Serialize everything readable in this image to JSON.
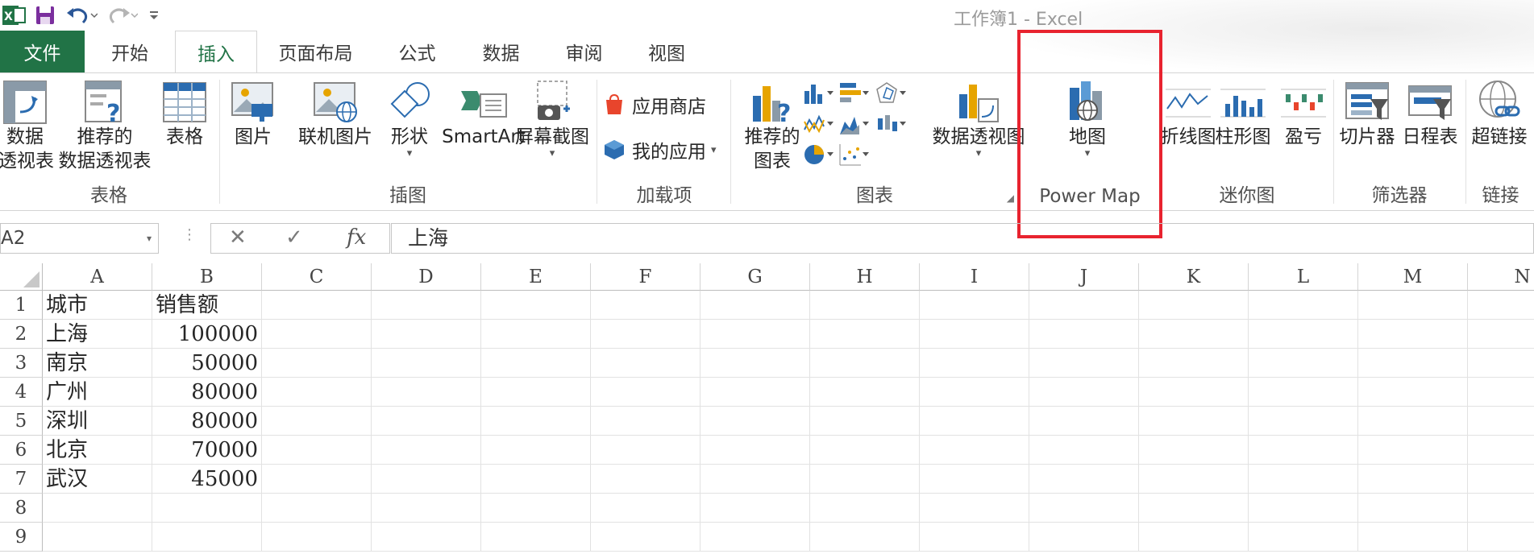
{
  "window": {
    "title": "工作簿1 - Excel"
  },
  "tabs": [
    {
      "label": "文件"
    },
    {
      "label": "开始"
    },
    {
      "label": "插入"
    },
    {
      "label": "页面布局"
    },
    {
      "label": "公式"
    },
    {
      "label": "数据"
    },
    {
      "label": "审阅"
    },
    {
      "label": "视图"
    }
  ],
  "ribbon": {
    "tables": {
      "label": "表格",
      "pivot": [
        "数据",
        "透视表"
      ],
      "recommended_pivot": [
        "推荐的",
        "数据透视表"
      ],
      "table": "表格"
    },
    "illustrations": {
      "label": "插图",
      "picture": "图片",
      "online_picture": "联机图片",
      "shapes": "形状",
      "smartart": "SmartArt",
      "screenshot": "屏幕截图"
    },
    "addins": {
      "label": "加载项",
      "store": "应用商店",
      "my_apps": "我的应用"
    },
    "charts": {
      "label": "图表",
      "recommended": [
        "推荐的",
        "图表"
      ],
      "pivot_chart": "数据透视图"
    },
    "power_map": {
      "label": "Power Map",
      "map": "地图"
    },
    "sparklines": {
      "label": "迷你图",
      "line": "折线图",
      "column": "柱形图",
      "winloss": "盈亏"
    },
    "filters": {
      "label": "筛选器",
      "slicer": "切片器",
      "timeline": "日程表"
    },
    "links": {
      "label": "链接",
      "hyperlink": "超链接"
    }
  },
  "formula_bar": {
    "name_box": "A2",
    "fx": "fx",
    "value": "上海"
  },
  "sheet": {
    "columns": [
      "A",
      "B",
      "C",
      "D",
      "E",
      "F",
      "G",
      "H",
      "I",
      "J",
      "K",
      "L",
      "M",
      "N"
    ],
    "rows": [
      "1",
      "2",
      "3",
      "4",
      "5",
      "6",
      "7",
      "8",
      "9"
    ],
    "data": [
      [
        "城市",
        "销售额"
      ],
      [
        "上海",
        "100000"
      ],
      [
        "南京",
        "50000"
      ],
      [
        "广州",
        "80000"
      ],
      [
        "深圳",
        "80000"
      ],
      [
        "北京",
        "70000"
      ],
      [
        "武汉",
        "45000"
      ]
    ]
  },
  "colors": {
    "accent": "#217346",
    "highlight": "#e8232f"
  }
}
